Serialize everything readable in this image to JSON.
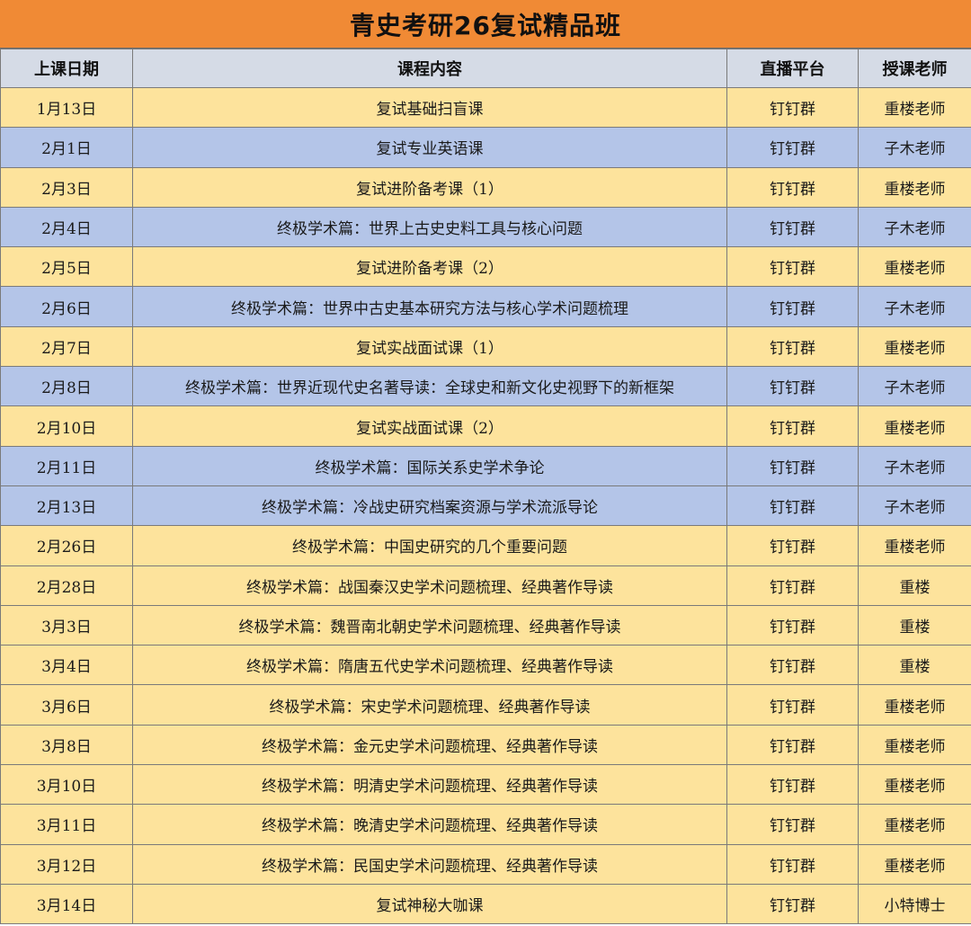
{
  "title": "青史考研26复试精品班",
  "columns": {
    "date": "上课日期",
    "content": "课程内容",
    "platform": "直播平台",
    "teacher": "授课老师"
  },
  "colors": {
    "title_bg": "#f08a35",
    "header_bg": "#d5dbe6",
    "row_yellow": "#fde39c",
    "row_blue": "#b4c5e8"
  },
  "rows": [
    {
      "date": "1月13日",
      "content": "复试基础扫盲课",
      "platform": "钉钉群",
      "teacher": "重楼老师",
      "color": "yellow"
    },
    {
      "date": "2月1日",
      "content": "复试专业英语课",
      "platform": "钉钉群",
      "teacher": "子木老师",
      "color": "blue"
    },
    {
      "date": "2月3日",
      "content": "复试进阶备考课（1）",
      "platform": "钉钉群",
      "teacher": "重楼老师",
      "color": "yellow"
    },
    {
      "date": "2月4日",
      "content": "终极学术篇：世界上古史史料工具与核心问题",
      "platform": "钉钉群",
      "teacher": "子木老师",
      "color": "blue"
    },
    {
      "date": "2月5日",
      "content": "复试进阶备考课（2）",
      "platform": "钉钉群",
      "teacher": "重楼老师",
      "color": "yellow"
    },
    {
      "date": "2月6日",
      "content": "终极学术篇：世界中古史基本研究方法与核心学术问题梳理",
      "platform": "钉钉群",
      "teacher": "子木老师",
      "color": "blue"
    },
    {
      "date": "2月7日",
      "content": "复试实战面试课（1）",
      "platform": "钉钉群",
      "teacher": "重楼老师",
      "color": "yellow"
    },
    {
      "date": "2月8日",
      "content": "终极学术篇：世界近现代史名著导读：全球史和新文化史视野下的新框架",
      "platform": "钉钉群",
      "teacher": "子木老师",
      "color": "blue"
    },
    {
      "date": "2月10日",
      "content": "复试实战面试课（2）",
      "platform": "钉钉群",
      "teacher": "重楼老师",
      "color": "yellow"
    },
    {
      "date": "2月11日",
      "content": "终极学术篇：国际关系史学术争论",
      "platform": "钉钉群",
      "teacher": "子木老师",
      "color": "blue"
    },
    {
      "date": "2月13日",
      "content": "终极学术篇：冷战史研究档案资源与学术流派导论",
      "platform": "钉钉群",
      "teacher": "子木老师",
      "color": "blue"
    },
    {
      "date": "2月26日",
      "content": "终极学术篇：中国史研究的几个重要问题",
      "platform": "钉钉群",
      "teacher": "重楼老师",
      "color": "yellow"
    },
    {
      "date": "2月28日",
      "content": "终极学术篇：战国秦汉史学术问题梳理、经典著作导读",
      "platform": "钉钉群",
      "teacher": "重楼",
      "color": "yellow"
    },
    {
      "date": "3月3日",
      "content": "终极学术篇：魏晋南北朝史学术问题梳理、经典著作导读",
      "platform": "钉钉群",
      "teacher": "重楼",
      "color": "yellow"
    },
    {
      "date": "3月4日",
      "content": "终极学术篇：隋唐五代史学术问题梳理、经典著作导读",
      "platform": "钉钉群",
      "teacher": "重楼",
      "color": "yellow"
    },
    {
      "date": "3月6日",
      "content": "终极学术篇：宋史学术问题梳理、经典著作导读",
      "platform": "钉钉群",
      "teacher": "重楼老师",
      "color": "yellow"
    },
    {
      "date": "3月8日",
      "content": "终极学术篇：金元史学术问题梳理、经典著作导读",
      "platform": "钉钉群",
      "teacher": "重楼老师",
      "color": "yellow"
    },
    {
      "date": "3月10日",
      "content": "终极学术篇：明清史学术问题梳理、经典著作导读",
      "platform": "钉钉群",
      "teacher": "重楼老师",
      "color": "yellow"
    },
    {
      "date": "3月11日",
      "content": "终极学术篇：晚清史学术问题梳理、经典著作导读",
      "platform": "钉钉群",
      "teacher": "重楼老师",
      "color": "yellow"
    },
    {
      "date": "3月12日",
      "content": "终极学术篇：民国史学术问题梳理、经典著作导读",
      "platform": "钉钉群",
      "teacher": "重楼老师",
      "color": "yellow"
    },
    {
      "date": "3月14日",
      "content": "复试神秘大咖课",
      "platform": "钉钉群",
      "teacher": "小特博士",
      "color": "yellow"
    }
  ]
}
